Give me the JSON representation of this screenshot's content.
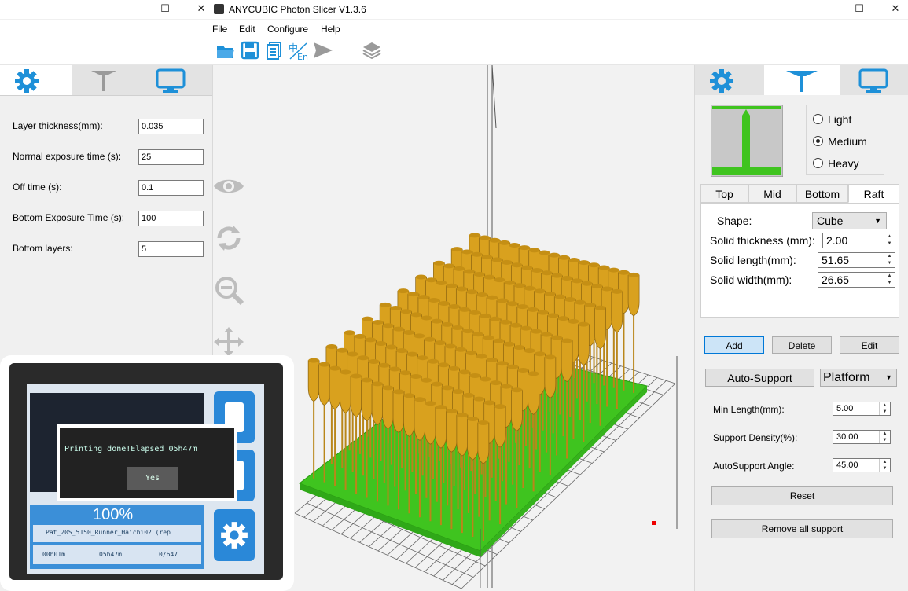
{
  "window": {
    "title": "ANYCUBIC Photon Slicer V1.3.6",
    "minimize": "—",
    "maximize": "☐",
    "close": "✕"
  },
  "menu": [
    "File",
    "Edit",
    "Configure",
    "Help"
  ],
  "toolbar": {
    "icons": [
      "open-folder-icon",
      "save-icon",
      "slice-icon",
      "language-icon",
      "send-icon",
      "layers-icon"
    ]
  },
  "left_panel": {
    "tabs": [
      "settings-gear",
      "support-tree",
      "monitor"
    ],
    "fields": [
      {
        "label": "Layer thickness(mm):",
        "value": "0.035"
      },
      {
        "label": "Normal exposure time (s):",
        "value": "25"
      },
      {
        "label": "Off time (s):",
        "value": "0.1"
      },
      {
        "label": "Bottom Exposure Time (s):",
        "value": "100"
      },
      {
        "label": "Bottom layers:",
        "value": "5"
      }
    ],
    "tools": [
      "eye-icon",
      "rotate-icon",
      "zoom-icon",
      "move-icon"
    ]
  },
  "right_panel": {
    "density": {
      "options": [
        "Light",
        "Medium",
        "Heavy"
      ],
      "selected": "Medium"
    },
    "subtabs": [
      "Top",
      "Mid",
      "Bottom",
      "Raft"
    ],
    "active_subtab": "Raft",
    "raft": {
      "shape_label": "Shape:",
      "shape_value": "Cube",
      "thickness_label": "Solid thickness (mm):",
      "thickness_value": "2.00",
      "length_label": "Solid length(mm):",
      "length_value": "51.65",
      "width_label": "Solid width(mm):",
      "width_value": "26.65"
    },
    "buttons": {
      "add": "Add",
      "delete": "Delete",
      "edit": "Edit"
    },
    "auto_support": "Auto-Support",
    "platform": "Platform",
    "params": {
      "min_length_label": "Min Length(mm):",
      "min_length_value": "5.00",
      "density_label": "Support Density(%):",
      "density_value": "30.00",
      "angle_label": "AutoSupport Angle:",
      "angle_value": "45.00"
    },
    "reset": "Reset",
    "remove_all": "Remove all support"
  },
  "photo": {
    "dialog_text": "Printing done!Elapsed 05h47m",
    "dialog_button": "Yes",
    "percent": "100%",
    "file": "Pat_20S_5150_Runner_Haichi02 (rep",
    "t1": "00h01m",
    "t2": "05h47m",
    "layers": "0/647"
  },
  "colors": {
    "accent_blue": "#1e90d8",
    "part": "#d9a11e",
    "raft": "#3fc41f"
  }
}
